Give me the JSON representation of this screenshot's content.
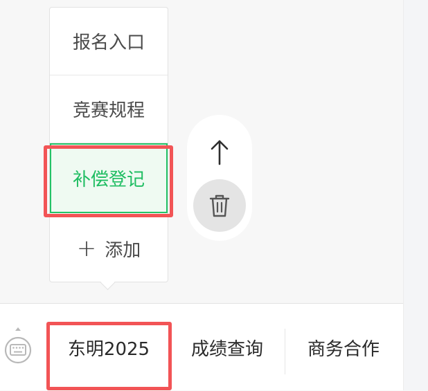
{
  "submenu": {
    "items": [
      {
        "label": "报名入口",
        "active": false
      },
      {
        "label": "竞赛规程",
        "active": false
      },
      {
        "label": "补偿登记",
        "active": true
      }
    ],
    "add_label": "添加"
  },
  "actions": {
    "move_up_icon": "arrow-up-icon",
    "delete_icon": "trash-icon"
  },
  "menu_bar": {
    "items": [
      {
        "label": "东明2025"
      },
      {
        "label": "成绩查询"
      },
      {
        "label": "商务合作"
      }
    ],
    "keyboard_icon": "keyboard-icon"
  },
  "colors": {
    "active_green": "#1fbd62",
    "highlight_red": "#f25456",
    "delete_bg": "#e4e4e4"
  }
}
